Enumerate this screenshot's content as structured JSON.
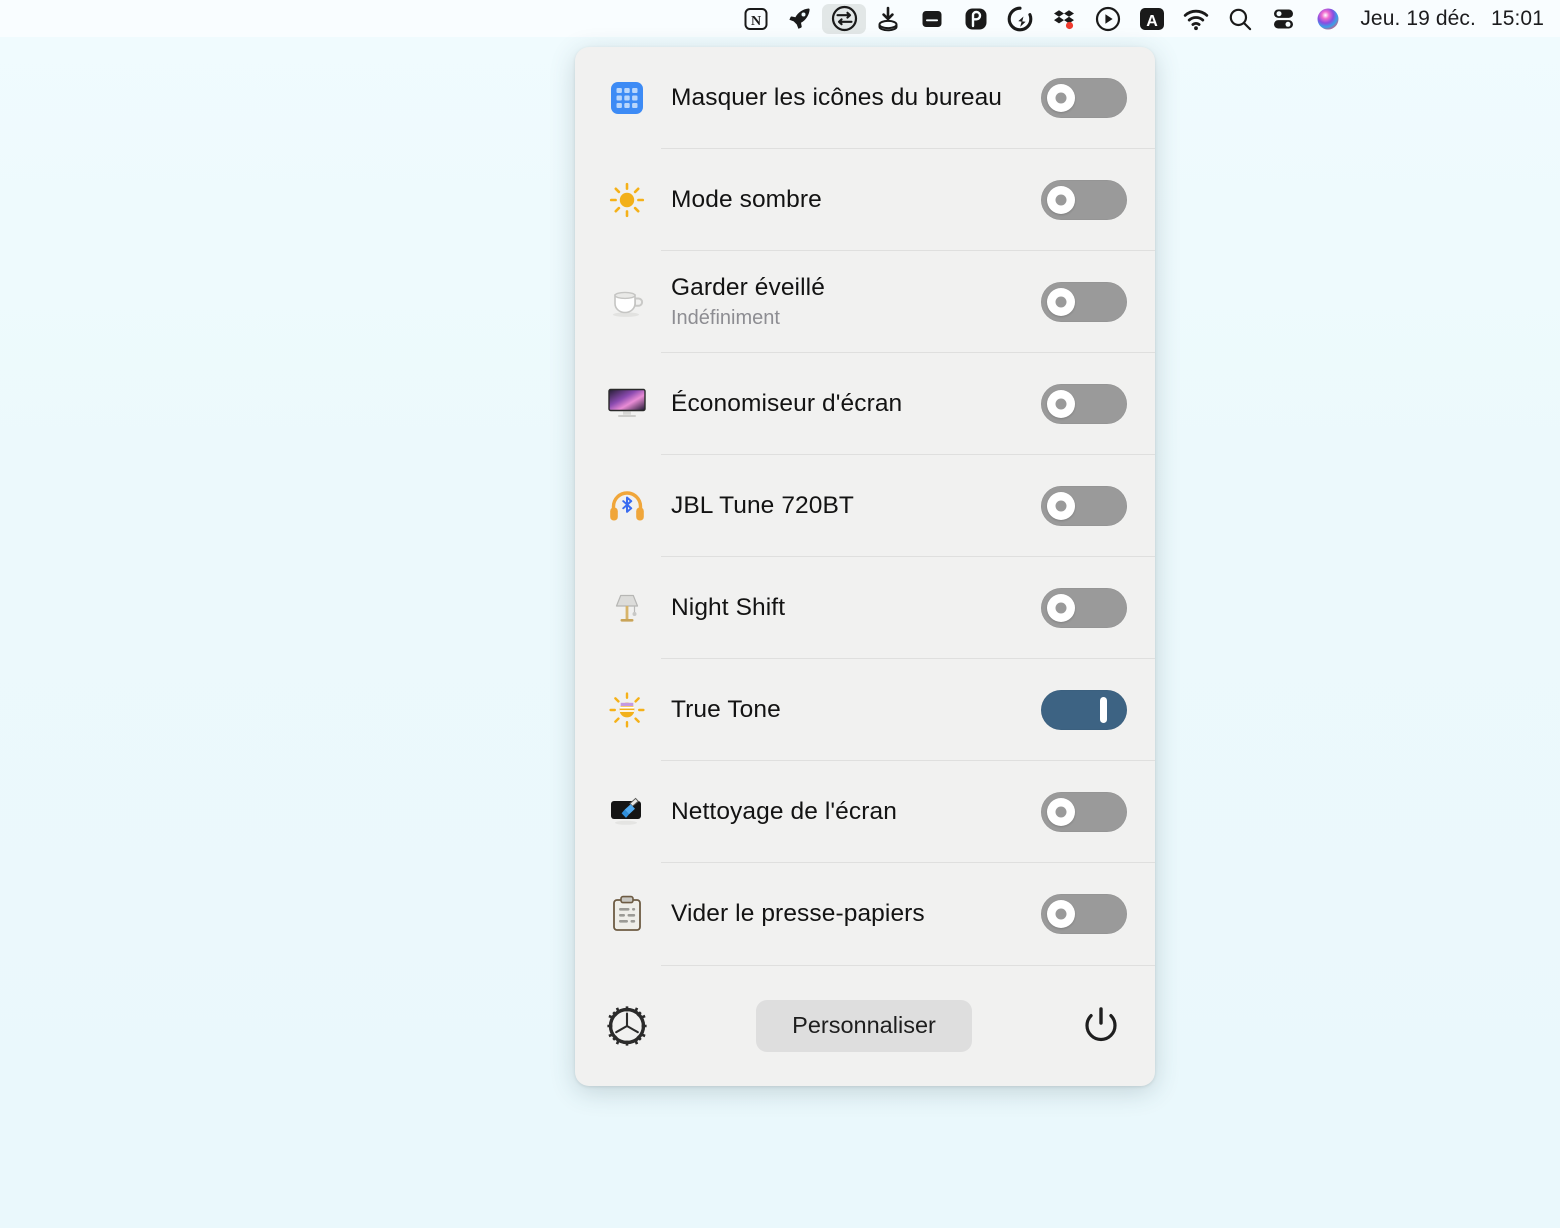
{
  "menubar": {
    "icons": [
      {
        "name": "notion-icon",
        "glyph": "N"
      },
      {
        "name": "rocket-icon",
        "glyph": "rocket"
      },
      {
        "name": "one-switch-icon",
        "glyph": "toggles",
        "active": true
      },
      {
        "name": "downie-icon",
        "glyph": "download"
      },
      {
        "name": "bartender-icon",
        "glyph": "bar"
      },
      {
        "name": "permute-icon",
        "glyph": "p-circle"
      },
      {
        "name": "quick-icon",
        "glyph": "q-circle"
      },
      {
        "name": "dropbox-icon",
        "glyph": "dropbox"
      },
      {
        "name": "player-icon",
        "glyph": "play-circle"
      },
      {
        "name": "abc-input-icon",
        "glyph": "A"
      },
      {
        "name": "wifi-icon",
        "glyph": "wifi"
      },
      {
        "name": "spotlight-search-icon",
        "glyph": "search"
      },
      {
        "name": "control-center-icon",
        "glyph": "control-center"
      },
      {
        "name": "siri-icon",
        "glyph": "siri"
      }
    ],
    "date": "Jeu. 19 déc.",
    "time": "15:01"
  },
  "panel": {
    "rows": [
      {
        "id": "hide-desktop-icons",
        "icon": "desktop-grid-icon",
        "emoji": "",
        "title": "Masquer les icônes du bureau",
        "subtitle": "",
        "toggle": "off"
      },
      {
        "id": "dark-mode",
        "icon": "sun-icon",
        "emoji": "☀️",
        "title": "Mode sombre",
        "subtitle": "",
        "toggle": "off"
      },
      {
        "id": "keep-awake",
        "icon": "coffee-cup-icon",
        "emoji": "☕️",
        "title": "Garder éveillé",
        "subtitle": "Indéfiniment",
        "toggle": "off"
      },
      {
        "id": "screen-saver",
        "icon": "monitor-screensaver-icon",
        "emoji": "🖥",
        "title": "Économiseur d'écran",
        "subtitle": "",
        "toggle": "off"
      },
      {
        "id": "bluetooth-headphones",
        "icon": "bluetooth-headphones-icon",
        "emoji": "🎧",
        "title": "JBL Tune 720BT",
        "subtitle": "",
        "toggle": "off"
      },
      {
        "id": "night-shift",
        "icon": "lamp-icon",
        "emoji": "💡",
        "title": "Night Shift",
        "subtitle": "",
        "toggle": "off"
      },
      {
        "id": "true-tone",
        "icon": "sun-tone-icon",
        "emoji": "🔆",
        "title": "True Tone",
        "subtitle": "",
        "toggle": "on"
      },
      {
        "id": "screen-cleaning",
        "icon": "screen-clean-icon",
        "emoji": "🧹",
        "title": "Nettoyage de l'écran",
        "subtitle": "",
        "toggle": "off"
      },
      {
        "id": "clear-clipboard",
        "icon": "clipboard-icon",
        "emoji": "📋",
        "title": "Vider le presse-papiers",
        "subtitle": "",
        "toggle": "off"
      }
    ],
    "footer": {
      "settings_icon": "gear-icon",
      "customize_label": "Personnaliser",
      "quit_icon": "power-icon"
    }
  },
  "colors": {
    "desktop_background": "#edfafd",
    "panel_background": "#f1f1f0",
    "toggle_off": "#9a9a9a",
    "toggle_on": "#3d6383",
    "separator": "#dfdfde",
    "button_background": "#dedede",
    "text_primary": "#131313",
    "text_secondary": "#8d8d92"
  }
}
